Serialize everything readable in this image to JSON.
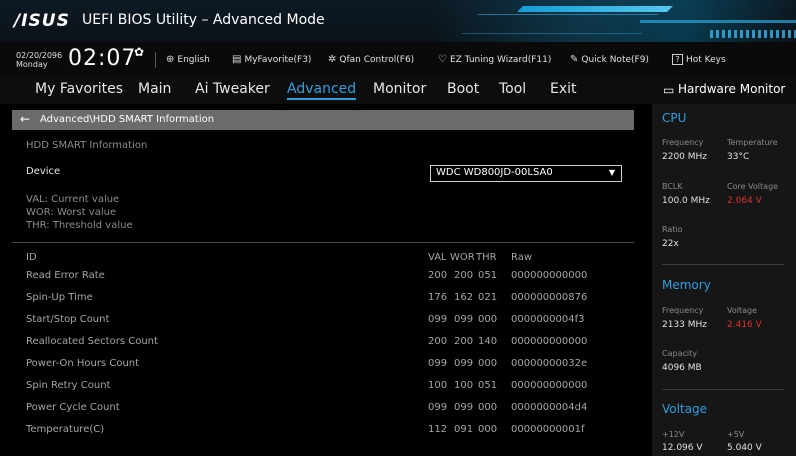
{
  "header": {
    "logo": "/ISUS",
    "title": "UEFI BIOS Utility – Advanced Mode"
  },
  "toolbar": {
    "date": "02/20/2096",
    "day": "Monday",
    "time": "02:07",
    "items": [
      {
        "icon": "globe-icon",
        "label": "English"
      },
      {
        "icon": "favorite-icon",
        "label": "MyFavorite(F3)"
      },
      {
        "icon": "fan-icon",
        "label": "Qfan Control(F6)"
      },
      {
        "icon": "bulb-icon",
        "label": "EZ Tuning Wizard(F11)"
      },
      {
        "icon": "note-icon",
        "label": "Quick Note(F9)"
      },
      {
        "icon": "hotkey-icon",
        "label": "Hot Keys"
      }
    ]
  },
  "nav": {
    "tabs": [
      "My Favorites",
      "Main",
      "Ai Tweaker",
      "Advanced",
      "Monitor",
      "Boot",
      "Tool",
      "Exit"
    ],
    "active": "Advanced"
  },
  "breadcrumb": "Advanced\\HDD SMART Information",
  "main": {
    "section_title": "HDD SMART Information",
    "device_label": "Device",
    "device_value": "WDC WD800JD-00LSA0",
    "legend": [
      "VAL: Current value",
      "WOR: Worst value",
      "THR:  Threshold value"
    ],
    "table": {
      "headers": [
        "ID",
        "VAL",
        "WOR",
        "THR",
        "Raw"
      ],
      "rows": [
        [
          "Read Error Rate",
          "200",
          "200",
          "051",
          "000000000000"
        ],
        [
          "Spin-Up Time",
          "176",
          "162",
          "021",
          "000000000876"
        ],
        [
          "Start/Stop Count",
          "099",
          "099",
          "000",
          "0000000004f3"
        ],
        [
          "Reallocated Sectors Count",
          "200",
          "200",
          "140",
          "000000000000"
        ],
        [
          "Power-On Hours Count",
          "099",
          "099",
          "000",
          "00000000032e"
        ],
        [
          "Spin Retry Count",
          "100",
          "100",
          "051",
          "000000000000"
        ],
        [
          "Power Cycle Count",
          "099",
          "099",
          "000",
          "0000000004d4"
        ],
        [
          "Temperature(C)",
          "112",
          "091",
          "000",
          "00000000001f"
        ]
      ]
    }
  },
  "hardware_monitor": {
    "title": "Hardware Monitor",
    "cpu": {
      "title": "CPU",
      "frequency_label": "Frequency",
      "frequency": "2200 MHz",
      "temperature_label": "Temperature",
      "temperature": "33°C",
      "bclk_label": "BCLK",
      "bclk": "100.0 MHz",
      "core_voltage_label": "Core Voltage",
      "core_voltage": "2.064 V",
      "ratio_label": "Ratio",
      "ratio": "22x"
    },
    "memory": {
      "title": "Memory",
      "frequency_label": "Frequency",
      "frequency": "2133 MHz",
      "voltage_label": "Voltage",
      "voltage": "2.416 V",
      "capacity_label": "Capacity",
      "capacity": "4096 MB"
    },
    "voltage": {
      "title": "Voltage",
      "v12_label": "+12V",
      "v12": "12.096 V",
      "v5_label": "+5V",
      "v5": "5.040 V"
    }
  },
  "colors": {
    "accent": "#2f9fe0",
    "warning": "#e03030",
    "breadcrumb_bg": "#6b6b6b"
  }
}
